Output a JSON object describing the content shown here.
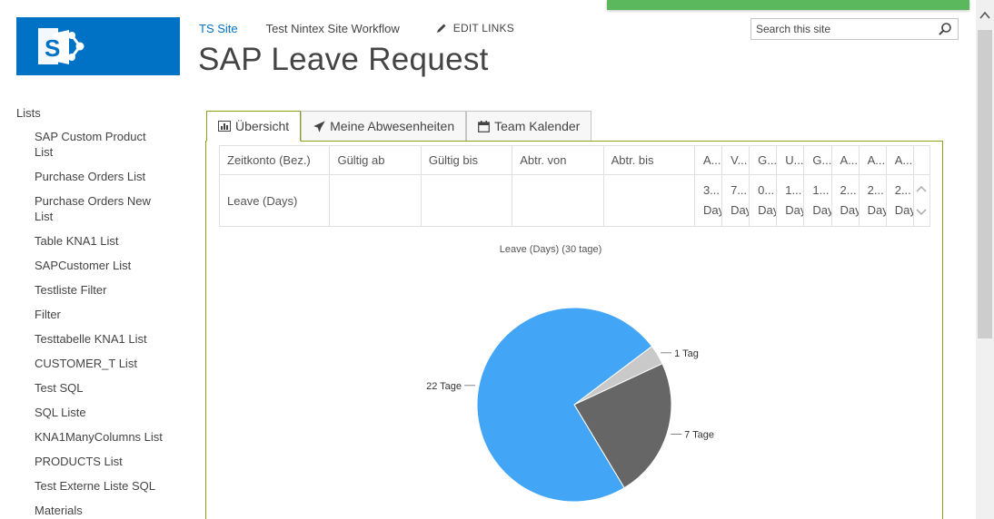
{
  "header": {
    "site_link": "TS Site",
    "workflow_link": "Test Nintex Site Workflow",
    "edit_links": "EDIT LINKS",
    "page_title": "SAP Leave Request",
    "search_placeholder": "Search this site"
  },
  "leftnav": {
    "heading": "Lists",
    "items": [
      "SAP Custom Product List",
      "Purchase Orders List",
      "Purchase Orders New List",
      "Table KNA1 List",
      "SAPCustomer List",
      "Testliste Filter",
      "Filter",
      "Testtabelle KNA1 List",
      "CUSTOMER_T List",
      "Test SQL",
      "SQL Liste",
      "KNA1ManyColumns List",
      "PRODUCTS List",
      "Test Externe Liste SQL",
      "Materials"
    ]
  },
  "tabs": [
    {
      "label": "Übersicht",
      "icon": "bar-chart-icon",
      "active": true
    },
    {
      "label": "Meine Abwesenheiten",
      "icon": "plane-icon",
      "active": false
    },
    {
      "label": "Team Kalender",
      "icon": "calendar-icon",
      "active": false
    }
  ],
  "table": {
    "headers": [
      "Zeitkonto (Bez.)",
      "Gültig ab",
      "Gültig bis",
      "Abtr. von",
      "Abtr. bis",
      "A...",
      "V...",
      "G...",
      "U...",
      "G...",
      "A...",
      "A...",
      "A..."
    ],
    "row": {
      "name": "Leave (Days)",
      "gueltig_ab": "",
      "gueltig_bis": "",
      "abtr_von": "",
      "abtr_bis": "",
      "cells": [
        {
          "v": "3...",
          "u": "Day"
        },
        {
          "v": "7...",
          "u": "Day"
        },
        {
          "v": "0...",
          "u": "Day"
        },
        {
          "v": "1...",
          "u": "Day"
        },
        {
          "v": "1...",
          "u": "Day"
        },
        {
          "v": "2...",
          "u": "Day"
        },
        {
          "v": "2...",
          "u": "Day"
        },
        {
          "v": "2...",
          "u": "Day"
        }
      ]
    }
  },
  "chart_data": {
    "type": "pie",
    "title": "Leave (Days) (30 tage)",
    "slices": [
      {
        "label": "22 Tage",
        "value": 22,
        "color": "#42a5f5"
      },
      {
        "label": "1 Tag",
        "value": 1,
        "color": "#c9c9c9"
      },
      {
        "label": "7 Tage",
        "value": 7,
        "color": "#666666"
      }
    ]
  },
  "colors": {
    "brand": "#0072c6",
    "accent_border": "#8aa31a",
    "notification": "#5cb85c"
  }
}
